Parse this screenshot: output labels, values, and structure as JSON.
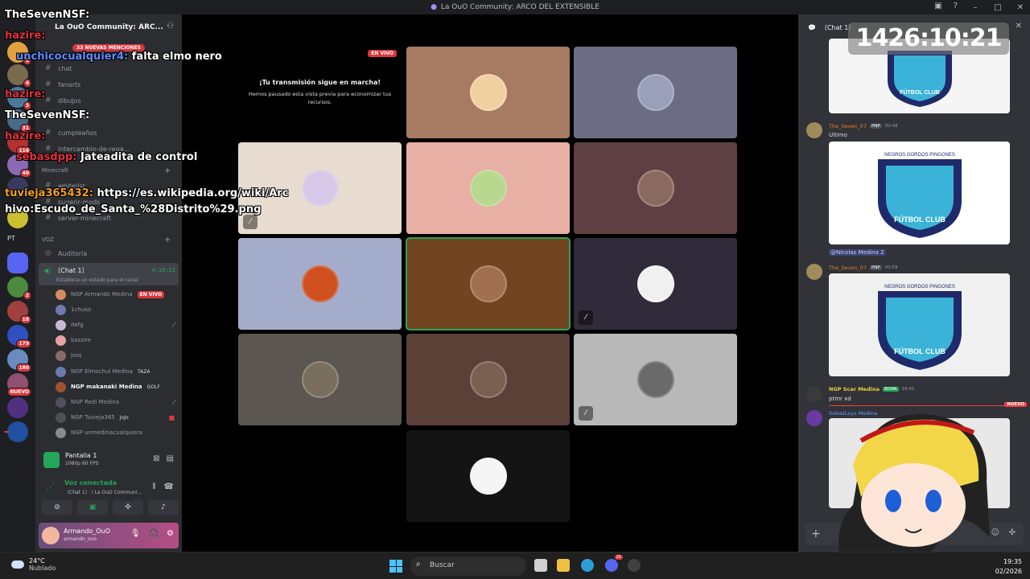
{
  "window": {
    "title": "La OuO Community: ARCO DEL EXTENSIBLE"
  },
  "server": {
    "name": "La OuO Community: ARC...",
    "mentions_pill": "33 NUEVAS MENCIONES"
  },
  "rail_badges": [
    "1",
    "4",
    "3",
    "31",
    "116",
    "40",
    "2",
    "18",
    "179",
    "180",
    "NUEVO"
  ],
  "rail_label": "PT",
  "channels": [
    {
      "label": "chat"
    },
    {
      "label": "fanarts"
    },
    {
      "label": "dibujos"
    },
    {
      "label": "romandos"
    },
    {
      "label": "cumpleaños"
    },
    {
      "label": "intercambio-de-rega..."
    },
    {
      "label": "whitelist"
    },
    {
      "label": "sugerir-mods"
    },
    {
      "label": "server-minecraft"
    }
  ],
  "categories": {
    "minecraft": "Minecraft",
    "voz": "VOZ"
  },
  "voice": {
    "auditoria": "Auditoría",
    "active_channel": "〔Chat 1〕",
    "elapsed": "4:19:52",
    "status_prompt": "Establece un estado para el canal",
    "members": [
      {
        "name": "NGP Armando Medina",
        "badge": "EN VIVO"
      },
      {
        "name": "1chuso",
        "badge": ""
      },
      {
        "name": "defg",
        "badge": ""
      },
      {
        "name": "bazzire",
        "badge": ""
      },
      {
        "name": "joss",
        "badge": ""
      },
      {
        "name": "NGP Elmochul Medina",
        "badge": "TAZA"
      },
      {
        "name": "NGP makanaki Medina",
        "badge": "GOLF"
      },
      {
        "name": "NGP Redi Medina",
        "badge": ""
      },
      {
        "name": "NGP Tuvieja365",
        "badge": "JoJo"
      },
      {
        "name": "NGP unmedinacualquiera",
        "badge": ""
      }
    ]
  },
  "screen_share": {
    "title": "Pantalla 1",
    "quality": "1080p 60 FPS"
  },
  "voice_connection": {
    "status": "Voz conectada",
    "channel": "〔Chat 1〕 / La OuO Communi..."
  },
  "user": {
    "display": "Armando_OuO",
    "handle": "armando_ouo"
  },
  "stream_card": {
    "live_tag": "EN VIVO",
    "title": "¡Tu transmisión sigue en marcha!",
    "body_line1": "Hemos pausado esta vista previa para economizar tus",
    "body_line2": "recursos."
  },
  "overlay_chat": {
    "l1": "TheSevenNSF:",
    "l2_name": "hazire:",
    "l3_name": "unchicocualquier4:",
    "l3_text": "falta elmo nero",
    "l4_name": "hazire:",
    "l5": "TheSevenNSF:",
    "l6_name": "hazire:",
    "l7_name": "sebasdpp:",
    "l7_text": "Jateadita de control",
    "l8_name": "tuvieja365432:",
    "l8_text": "https://es.wikipedia.org/wiki/Arc",
    "l9": "hivo:Escudo_de_Santa_%28Distrito%29.png"
  },
  "chat_panel": {
    "header": "〔Chat 1〕",
    "timer": "1426:10:21",
    "image_text": "FÚTBOL CLUB",
    "image_top": "NEGROS GORDOS PINGONES",
    "messages": [
      {
        "author": "The_Seven_07",
        "tag": "PNP",
        "time": "00:48",
        "text": "Ultimo"
      },
      {
        "mention": "@Nicolas Medina 2"
      },
      {
        "author": "The_Seven_07",
        "tag": "PNP",
        "time": "00:59"
      },
      {
        "author": "NGP Scar Medina",
        "tag": "BONK",
        "time": "16:41",
        "text": "ptmr xd"
      },
      {
        "author": "SebasLays Medina"
      }
    ],
    "new_label": "NUEVO"
  },
  "taskbar": {
    "temp": "24°C",
    "weather": "Nublado",
    "search": "Buscar",
    "time": "19:35",
    "date": "02/2026",
    "discord_badge": "25"
  }
}
